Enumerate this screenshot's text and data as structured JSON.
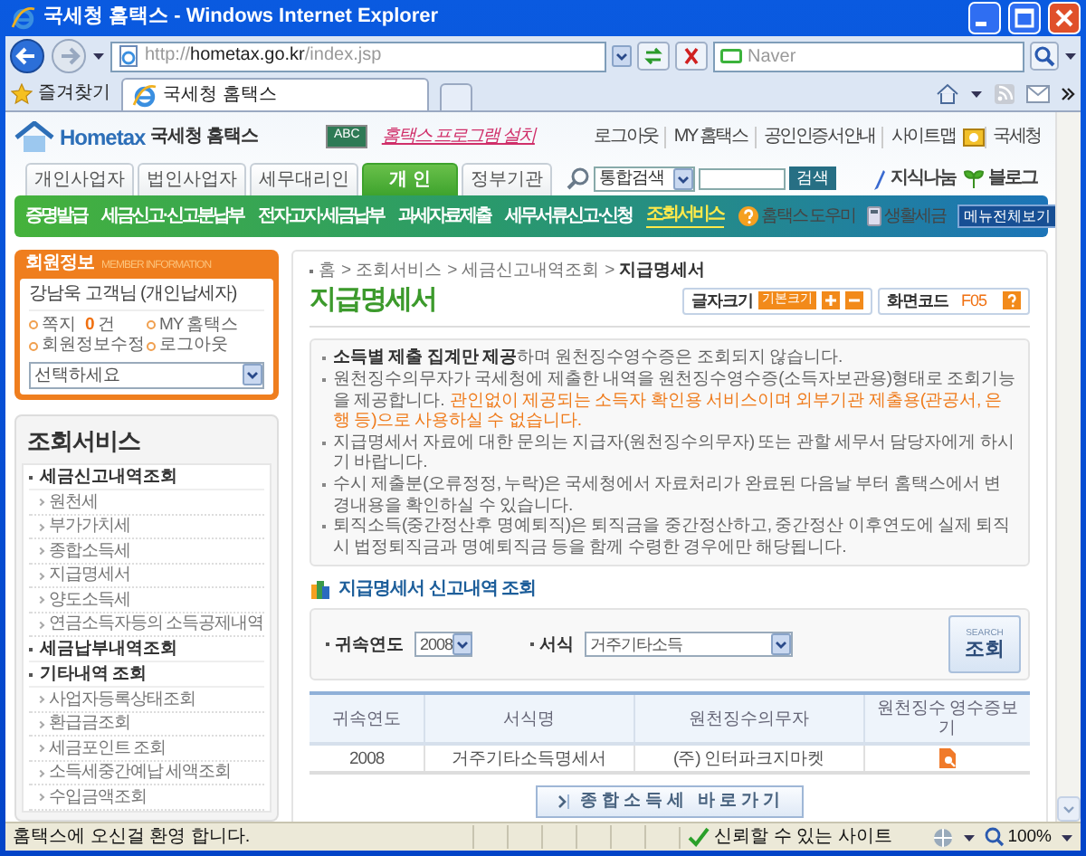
{
  "window": {
    "title": "국세청 홈택스 - Windows Internet Explorer"
  },
  "address_bar": {
    "scheme": "http://",
    "host": "hometax.go.kr",
    "path": "/index.jsp"
  },
  "search_box": {
    "placeholder": "Naver"
  },
  "favorites": {
    "label": "즐겨찾기"
  },
  "browser_tabs": [
    {
      "label": "국세청 홈택스",
      "selected": true
    }
  ],
  "site": {
    "logo": "Hometax",
    "name": "국세청 홈택스",
    "banner_badge": "ABC",
    "banner": "홈택스 프로그램 설치",
    "top_links": [
      "로그아웃",
      "MY 홈택스",
      "공인인증서안내",
      "사이트맵",
      "국세청"
    ],
    "user_tabs": [
      {
        "label": "개인사업자",
        "selected": false
      },
      {
        "label": "법인사업자",
        "selected": false
      },
      {
        "label": "세무대리인",
        "selected": false
      },
      {
        "label": "개 인",
        "selected": true
      },
      {
        "label": "정부기관",
        "selected": false
      }
    ],
    "search": {
      "scope": "통합검색",
      "button": "검색"
    },
    "extra_links": [
      "지식나눔",
      "블로그"
    ],
    "main_menu": [
      {
        "label": "증명발급",
        "selected": false
      },
      {
        "label": "세금신고·신고분납부",
        "selected": false
      },
      {
        "label": "전자고지·세금납부",
        "selected": false
      },
      {
        "label": "과세자료제출",
        "selected": false
      },
      {
        "label": "세무서류신고·신청",
        "selected": false
      },
      {
        "label": "조회서비스",
        "selected": true
      }
    ],
    "menu_tools": [
      "홈택스 도우미",
      "생활세금"
    ],
    "menu_all": "메뉴전체보기"
  },
  "member": {
    "title": "회원정보",
    "subtitle": "MEMBER INFORMATION",
    "user": "강남욱 고객님 (개인납세자)",
    "links": [
      {
        "label": "쪽지",
        "count": "0",
        "unit": "건"
      },
      {
        "label": "MY 홈택스"
      },
      {
        "label": "회원정보수정"
      },
      {
        "label": "로그아웃"
      }
    ],
    "select": "선택하세요"
  },
  "sidebar": {
    "title": "조회서비스",
    "items": [
      {
        "label": "세금신고내역조회",
        "children": [
          {
            "label": "원천세"
          },
          {
            "label": "부가가치세"
          },
          {
            "label": "종합소득세"
          },
          {
            "label": "지급명세서"
          },
          {
            "label": "양도소득세"
          },
          {
            "label": "연금소득자등의 소득공제내역"
          }
        ]
      },
      {
        "label": "세금납부내역조회"
      },
      {
        "label": "기타내역 조회",
        "children": [
          {
            "label": "사업자등록상태조회"
          },
          {
            "label": "환급금조회"
          },
          {
            "label": "세금포인트 조회"
          },
          {
            "label": "소득세중간예납 세액조회"
          },
          {
            "label": "수입금액조회"
          }
        ]
      }
    ]
  },
  "content": {
    "breadcrumb": [
      "홈",
      "조회서비스",
      "세금신고내역조회",
      "지급명세서"
    ],
    "breadcrumb_separator": ">",
    "title": "지급명세서",
    "font_size": {
      "label": "글자크기",
      "default": "기본크기"
    },
    "screen_code": {
      "label": "화면코드",
      "code": "F05"
    },
    "notices": [
      {
        "text": "**소득별 제출 집계만 제공**하며 원천징수영수증은 조회되지 않습니다."
      },
      {
        "text": "원천징수의무자가 국세청에 제출한 내역을 원천징수영수증(소득자보관용)형태로 조회기능을 제공합니다.",
        "warning": "관인없이 제공되는 소득자 확인용 서비스이며 외부기관 제출용(관공서, 은행 등)으로 사용하실 수 없습니다."
      },
      {
        "text": "지급명세서 자료에 대한 문의는 지급자(원천징수의무자) 또는 관할 세무서 담당자에게 하시기 바랍니다."
      },
      {
        "text": "수시 제출분(오류정정, 누락)은 국세청에서 자료처리가 완료된 다음날 부터 홈택스에서 변경내용을 확인하실 수 있습니다."
      },
      {
        "text": "퇴직소득(중간정산후 명예퇴직)은 퇴직금을 중간정산하고, 중간정산 이후연도에 실제 퇴직시 법정퇴직금과 명예퇴직금 등을 함께 수령한 경우에만 해당됩니다."
      }
    ],
    "section_title": "지급명세서 신고내역 조회",
    "filters": [
      {
        "label": "귀속연도",
        "value": "2008"
      },
      {
        "label": "서식",
        "value": "거주기타소득"
      }
    ],
    "search_button": {
      "caption": "SEARCH",
      "label": "조회"
    },
    "table": {
      "columns": [
        "귀속연도",
        "서식명",
        "원천징수의무자",
        "원천징수 영수증보기"
      ],
      "rows": [
        {
          "cells": [
            "2008",
            "거주기타소득명세서",
            "(주) 인터파크지마켓"
          ]
        }
      ]
    },
    "footer_button": "종합소득세 바로가기"
  },
  "status_bar": {
    "message": "홈택스에 오신걸 환영 합니다.",
    "zone": "신뢰할 수 있는 사이트",
    "zoom": "100%"
  }
}
